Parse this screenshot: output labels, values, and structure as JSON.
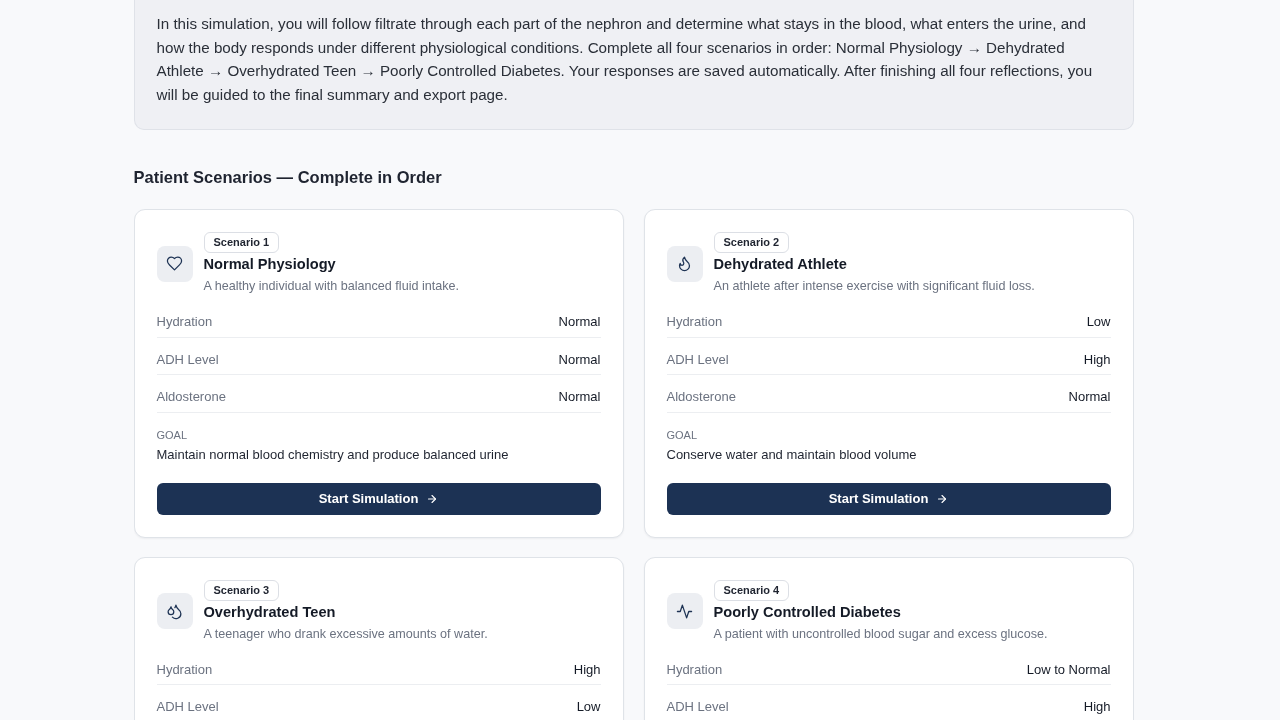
{
  "intro": {
    "text": "In this simulation, you will follow filtrate through each part of the nephron and determine what stays in the blood, what enters the urine, and how the body responds under different physiological conditions. Complete all four scenarios in order: Normal Physiology → Dehydrated Athlete → Overhydrated Teen → Poorly Controlled Diabetes. Your responses are saved automatically. After finishing all four reflections, you will be guided to the final summary and export page."
  },
  "section_title": "Patient Scenarios — Complete in Order",
  "scenarios": [
    {
      "kind": "heart",
      "badge": "Scenario 1",
      "title": "Normal Physiology",
      "description": "A healthy individual with balanced fluid intake.",
      "stats": [
        {
          "label": "Hydration",
          "value": "Normal"
        },
        {
          "label": "ADH Level",
          "value": "Normal"
        },
        {
          "label": "Aldosterone",
          "value": "Normal"
        }
      ],
      "goal_label": "GOAL",
      "goal": "Maintain normal blood chemistry and produce balanced urine",
      "button": "Start Simulation"
    },
    {
      "kind": "flame",
      "badge": "Scenario 2",
      "title": "Dehydrated Athlete",
      "description": "An athlete after intense exercise with significant fluid loss.",
      "stats": [
        {
          "label": "Hydration",
          "value": "Low"
        },
        {
          "label": "ADH Level",
          "value": "High"
        },
        {
          "label": "Aldosterone",
          "value": "Normal"
        }
      ],
      "goal_label": "GOAL",
      "goal": "Conserve water and maintain blood volume",
      "button": "Start Simulation"
    },
    {
      "kind": "droplets",
      "badge": "Scenario 3",
      "title": "Overhydrated Teen",
      "description": "A teenager who drank excessive amounts of water.",
      "stats": [
        {
          "label": "Hydration",
          "value": "High"
        },
        {
          "label": "ADH Level",
          "value": "Low"
        }
      ]
    },
    {
      "kind": "pulse",
      "badge": "Scenario 4",
      "title": "Poorly Controlled Diabetes",
      "description": "A patient with uncontrolled blood sugar and excess glucose.",
      "stats": [
        {
          "label": "Hydration",
          "value": "Low to Normal"
        },
        {
          "label": "ADH Level",
          "value": "High"
        }
      ]
    }
  ]
}
